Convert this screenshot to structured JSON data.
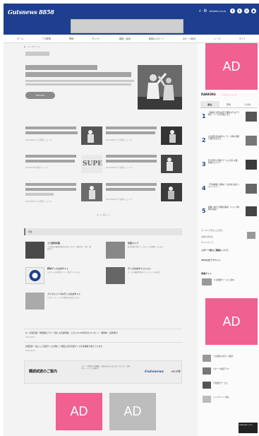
{
  "header": {
    "logo": "Gutsnews 8858",
    "login_link": "MEMBER LOGIN",
    "icons": [
      "search-icon",
      "gear-icon",
      "facebook-icon",
      "twitter-icon",
      "mail-icon",
      "user-icon"
    ]
  },
  "nav": {
    "items": [
      "ホーム",
      "プロ野球",
      "野球",
      "サッカー",
      "格闘・競技",
      "競馬&スポーツ",
      "スポーツ総合",
      "レース",
      "ライフ"
    ]
  },
  "breadcrumb": [
    "▶",
    "トップページ"
  ],
  "hero": {
    "button_label": "DETAILS"
  },
  "thumbs": {
    "logo_text": "SUPERS"
  },
  "meta": {
    "list_meta": [
      "2022/08/31 プロ野球 ニュース",
      "2022/08/31 プロ野球 ニュース",
      "2022/08/30 野球 ニュース",
      "2022/08/30 プロ野球 ニュース",
      "2022/08/30 プロ野球 ニュース",
      "2022/08/29 プロ野球 ニュース"
    ]
  },
  "more_label": "もっと見る ＋",
  "section": {
    "title": "特集",
    "features": [
      {
        "title": "プロ野球特集",
        "desc": "プロ野球の最新情報をお届けします。特集記事・写真・動画まで。"
      },
      {
        "title": "球団ライブ",
        "desc": "試合速報や選手インタビューを掲載しています。"
      },
      {
        "title": "野球グッズ公式サイト",
        "desc": "公式グッズの販売サイト。限定アイテムも。"
      },
      {
        "title": "グッズ公式ダイジェスト",
        "desc": "グッズの最新情報をダイジェストでお届け。"
      },
      {
        "title": "ブックシリーズ&グッズ公式サイト",
        "desc": "公式ブックシリーズの情報をお届けします。"
      }
    ]
  },
  "news": [
    {
      "text": "お・読者応援！年間購読プランで楽しむ応援特集・さらに10,000円分のプレゼント（期間中・応募受付）",
      "date": "2022/08/31"
    },
    {
      "text": "応援団の一員として応援グッズを購入！球団公式の応援グッズを多数取り揃えています。",
      "date": "2022/08/30"
    }
  ],
  "promo": {
    "title": "購読試読のご案内",
    "sub": "スポーツ新聞の定期購読・試読のお申し込みはこちらから。お得なキャンペーン実施中。",
    "logo1": "Gutsnews",
    "logo2": "ecrit"
  },
  "ads": {
    "label": "AD"
  },
  "sidebar": {
    "ranking_title": "RANKING",
    "ranking_sub": "アクセスランキング",
    "tabs": [
      "総合",
      "野球",
      "その他"
    ],
    "ranks": [
      {
        "num": "1",
        "text": "【速報】注目の試合で劇的なサヨナラ勝ち、チームが首位に浮上"
      },
      {
        "num": "2",
        "text": "主力選手が好調をキープ、今季の活躍に期待が高まる"
      },
      {
        "num": "3",
        "text": "若手選手の活躍でチームに新たな風、監督もコメント"
      },
      {
        "num": "4",
        "text": "【写真特集】熱戦の一日を振り返るベストショット"
      },
      {
        "num": "5",
        "text": "開幕に向けた準備が順調、キャンプ情報をお届け"
      }
    ],
    "links": [
      "ランキングをもっと見る",
      "お問い合わせ",
      "サイトマップ"
    ],
    "notice": "スポーツ紙のご購読について",
    "head2": "SNS公式アカウント",
    "head3": "関連サイト",
    "side_items": [
      "公式通販サイトのご案内",
      "プロ野球公式グッズ販売",
      "スポーツ情報アプリ",
      "写真販売サービス",
      "バックナンバー購入"
    ],
    "bottom_banner": "Gutsnews アプリ"
  }
}
